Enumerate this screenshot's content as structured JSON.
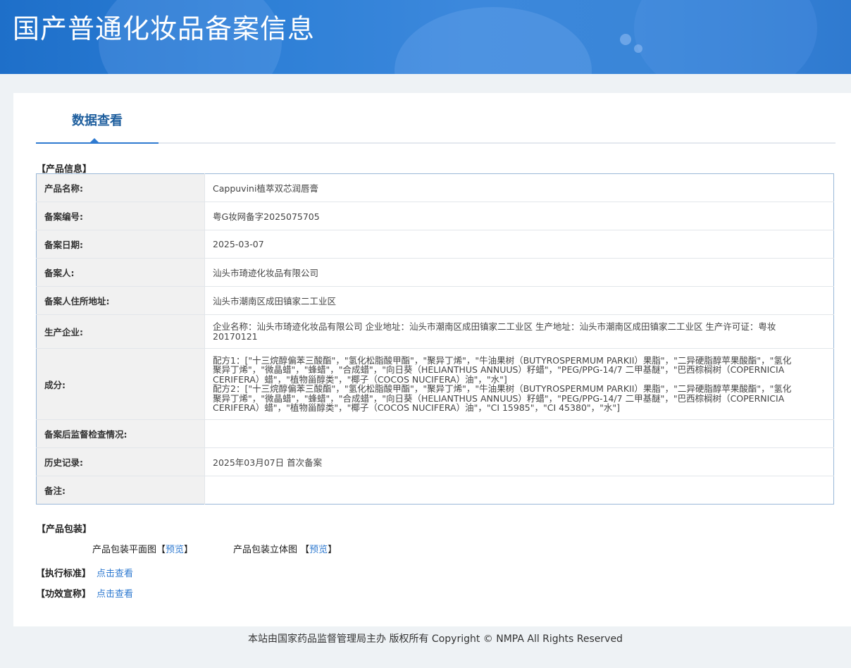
{
  "header": {
    "title": "国产普通化妆品备案信息"
  },
  "tabs": {
    "active_label": "数据查看"
  },
  "product_section": {
    "heading": "【产品信息】",
    "rows": [
      {
        "label": "产品名称:",
        "value": "Cappuvini植萃双芯润唇膏"
      },
      {
        "label": "备案编号:",
        "value": "粤G妆网备字2025075705"
      },
      {
        "label": "备案日期:",
        "value": "2025-03-07"
      },
      {
        "label": "备案人:",
        "value": "汕头市琦迹化妆品有限公司"
      },
      {
        "label": "备案人住所地址:",
        "value": "汕头市潮南区成田镇家二工业区"
      },
      {
        "label": "生产企业:",
        "value": "企业名称：汕头市琦迹化妆品有限公司 企业地址：汕头市潮南区成田镇家二工业区 生产地址：汕头市潮南区成田镇家二工业区 生产许可证：粤妆20170121"
      },
      {
        "label": "成分:",
        "formula1": "配方1：[\"十三烷醇偏苯三酸酯\"，\"氢化松脂酸甲酯\"，\"聚异丁烯\"，\"牛油果树（BUTYROSPERMUM PARKII）果脂\"，\"二异硬脂醇苹果酸酯\"，\"氢化聚异丁烯\"，\"微晶蜡\"，\"蜂蜡\"，\"合成蜡\"，\"向日葵（HELIANTHUS ANNUUS）籽蜡\"，\"PEG/PPG-14/7 二甲基醚\"，\"巴西棕榈树（COPERNICIA CERIFERA）蜡\"，\"植物甾醇类\"，\"椰子（COCOS NUCIFERA）油\"，\"水\"]",
        "formula2": "配方2：[\"十三烷醇偏苯三酸酯\"，\"氢化松脂酸甲酯\"，\"聚异丁烯\"，\"牛油果树（BUTYROSPERMUM PARKII）果脂\"，\"二异硬脂醇苹果酸酯\"，\"氢化聚异丁烯\"，\"微晶蜡\"，\"蜂蜡\"，\"合成蜡\"，\"向日葵（HELIANTHUS ANNUUS）籽蜡\"，\"PEG/PPG-14/7 二甲基醚\"，\"巴西棕榈树（COPERNICIA CERIFERA）蜡\"，\"植物甾醇类\"，\"椰子（COCOS NUCIFERA）油\"，\"CI 15985\"，\"CI 45380\"，\"水\"]"
      },
      {
        "label": "备案后监督检查情况:",
        "value": ""
      },
      {
        "label": "历史记录:",
        "value": "2025年03月07日 首次备案"
      },
      {
        "label": "备注:",
        "value": ""
      }
    ]
  },
  "packaging": {
    "heading": "【产品包装】",
    "flat_label": "产品包装平面图",
    "flat_link_open": "【",
    "flat_link": "预览",
    "flat_link_close": "】",
    "solid_label": "产品包装立体图",
    "solid_link_open": "【",
    "solid_link": "预览",
    "solid_link_close": "】"
  },
  "standards": {
    "label": "【执行标准】",
    "link": "点击查看"
  },
  "efficacy": {
    "label": "【功效宣称】",
    "link": "点击查看"
  },
  "footer": {
    "text": "本站由国家药品监督管理局主办 版权所有 Copyright © NMPA All Rights Reserved"
  }
}
